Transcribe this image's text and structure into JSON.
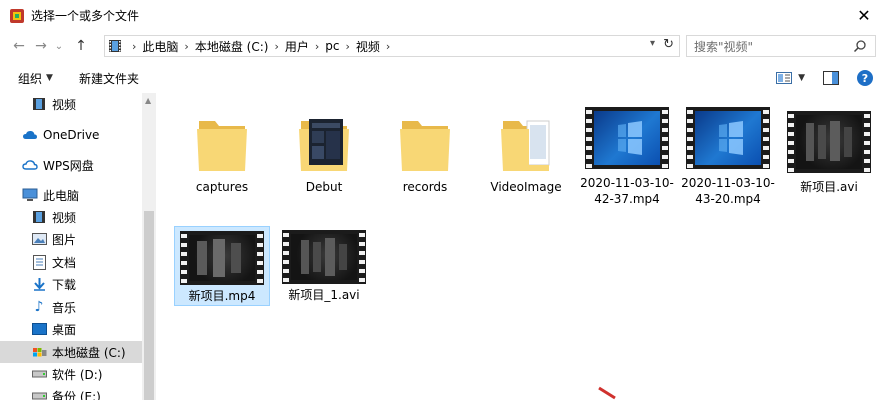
{
  "window": {
    "title": "选择一个或多个文件",
    "close_glyph": "✕"
  },
  "nav": {
    "back": "←",
    "forward": "→",
    "recent": "⌄",
    "up": "↑",
    "breadcrumbs": [
      "此电脑",
      "本地磁盘 (C:)",
      "用户",
      "pc",
      "视频"
    ],
    "search_placeholder": "搜索\"视频\""
  },
  "toolbar": {
    "organize_label": "组织",
    "new_folder_label": "新建文件夹"
  },
  "sidebar": {
    "items": [
      {
        "label": "视频",
        "icon": "video-folder-icon"
      },
      {
        "label": "OneDrive",
        "icon": "cloud-icon"
      },
      {
        "label": "WPS网盘",
        "icon": "wps-cloud-icon"
      },
      {
        "label": "此电脑",
        "icon": "computer-icon"
      },
      {
        "label": "视频",
        "icon": "video-folder-icon"
      },
      {
        "label": "图片",
        "icon": "pictures-icon"
      },
      {
        "label": "文档",
        "icon": "documents-icon"
      },
      {
        "label": "下载",
        "icon": "download-icon"
      },
      {
        "label": "音乐",
        "icon": "music-icon"
      },
      {
        "label": "桌面",
        "icon": "desktop-icon"
      },
      {
        "label": "本地磁盘 (C:)",
        "icon": "drive-c-icon"
      },
      {
        "label": "软件 (D:)",
        "icon": "drive-icon"
      },
      {
        "label": "备份 (E:)",
        "icon": "drive-icon"
      }
    ],
    "selected_index": 10
  },
  "files": [
    {
      "name": "captures",
      "kind": "folder"
    },
    {
      "name": "Debut",
      "kind": "folder-preview"
    },
    {
      "name": "records",
      "kind": "folder"
    },
    {
      "name": "VideoImage",
      "kind": "folder-doc"
    },
    {
      "name": "2020-11-03-10-42-37.mp4",
      "line1": "2020-11-03-10-",
      "line2": "42-37.mp4",
      "kind": "video-win"
    },
    {
      "name": "2020-11-03-10-43-20.mp4",
      "line1": "2020-11-03-10-",
      "line2": "43-20.mp4",
      "kind": "video-win"
    },
    {
      "name": "新项目.avi",
      "kind": "video-joker"
    },
    {
      "name": "新项目.mp4",
      "kind": "video-joker",
      "selected": true
    },
    {
      "name": "新项目_1.avi",
      "kind": "video-joker"
    }
  ],
  "colors": {
    "folder": "#f8d775",
    "folder_dark": "#e8b94a",
    "selection": "#cce8ff",
    "accent": "#1e6fc6"
  }
}
